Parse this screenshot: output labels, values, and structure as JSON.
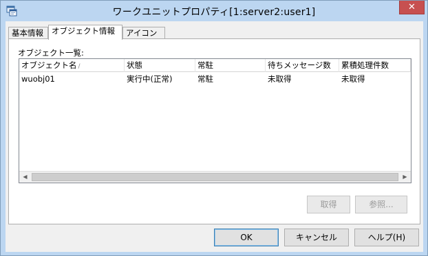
{
  "window": {
    "title": "ワークユニットプロパティ[1:server2:user1]",
    "close_glyph": "✕",
    "icon": "app-window-icon"
  },
  "tabs": [
    {
      "label": "基本情報",
      "active": false
    },
    {
      "label": "オブジェクト情報",
      "active": true
    },
    {
      "label": "アイコン",
      "active": false
    }
  ],
  "object_list": {
    "caption": "オブジェクト一覧:",
    "columns": [
      "オブジェクト名",
      "状態",
      "常駐",
      "待ちメッセージ数",
      "累積処理件数"
    ],
    "sort_indicator": "/",
    "rows": [
      [
        "wuobj01",
        "実行中(正常)",
        "常駐",
        "未取得",
        "未取得"
      ]
    ]
  },
  "scrollbar": {
    "left_arrow": "◀",
    "right_arrow": "▶"
  },
  "panel_buttons": {
    "acquire": "取得",
    "reference": "参照..."
  },
  "dialog_buttons": {
    "ok": "OK",
    "cancel": "キャンセル",
    "help": "ヘルプ(H)"
  },
  "colors": {
    "title_bar": "#bcd6f1",
    "close_button": "#c75050",
    "dialog_bg": "#f0f0f0"
  }
}
